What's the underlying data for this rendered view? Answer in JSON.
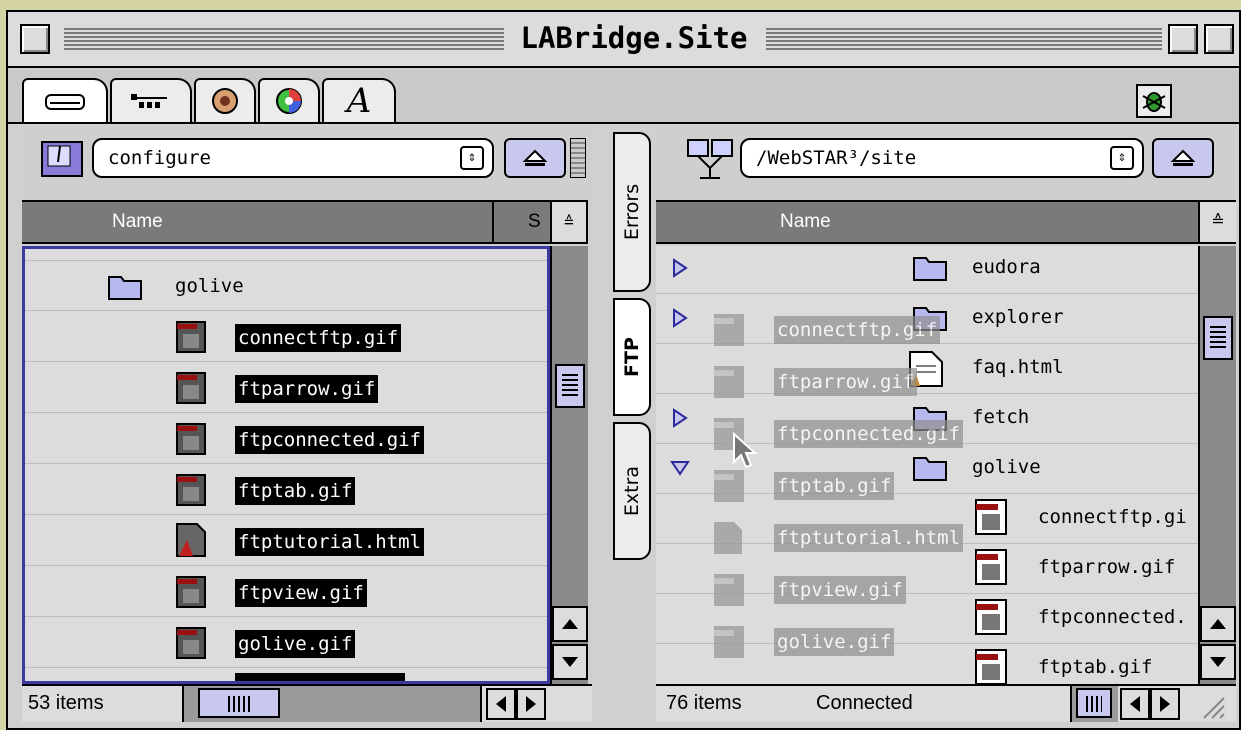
{
  "window": {
    "title": "LABridge.Site"
  },
  "tabs": [
    "Errors",
    "FTP",
    "Extra"
  ],
  "left": {
    "popup": "configure",
    "columns": {
      "name": "Name",
      "size": "S"
    },
    "items": [
      {
        "name": "golive",
        "kind": "folder"
      },
      {
        "name": "connectftp.gif",
        "kind": "gif"
      },
      {
        "name": "ftparrow.gif",
        "kind": "gif"
      },
      {
        "name": "ftpconnected.gif",
        "kind": "gif"
      },
      {
        "name": "ftptab.gif",
        "kind": "gif"
      },
      {
        "name": "ftptutorial.html",
        "kind": "html"
      },
      {
        "name": "ftpview.gif",
        "kind": "gif"
      },
      {
        "name": "golive.gif",
        "kind": "gif"
      }
    ],
    "status": "53 items"
  },
  "right": {
    "popup": "/WebSTAR³/site",
    "columns": {
      "name": "Name"
    },
    "items": [
      {
        "name": "eudora",
        "kind": "folder"
      },
      {
        "name": "explorer",
        "kind": "folder"
      },
      {
        "name": "faq.html",
        "kind": "html"
      },
      {
        "name": "fetch",
        "kind": "folder"
      },
      {
        "name": "golive",
        "kind": "folder"
      },
      {
        "name": "connectftp.gi",
        "kind": "gif"
      },
      {
        "name": "ftparrow.gif",
        "kind": "gif"
      },
      {
        "name": "ftpconnected.",
        "kind": "gif"
      },
      {
        "name": "ftptab.gif",
        "kind": "gif"
      }
    ],
    "drag_ghosts": [
      "connectftp.gif",
      "ftparrow.gif",
      "ftpconnected.gif",
      "ftptab.gif",
      "ftptutorial.html",
      "ftpview.gif",
      "golive.gif"
    ],
    "status_count": "76 items",
    "status_text": "Connected"
  },
  "icons": {
    "folder": "folder-icon",
    "gif": "gif-file-icon",
    "html": "html-file-icon"
  },
  "colors": {
    "accent": "#c8c8ee",
    "header": "#7a7a7a",
    "selection": "#000000"
  }
}
